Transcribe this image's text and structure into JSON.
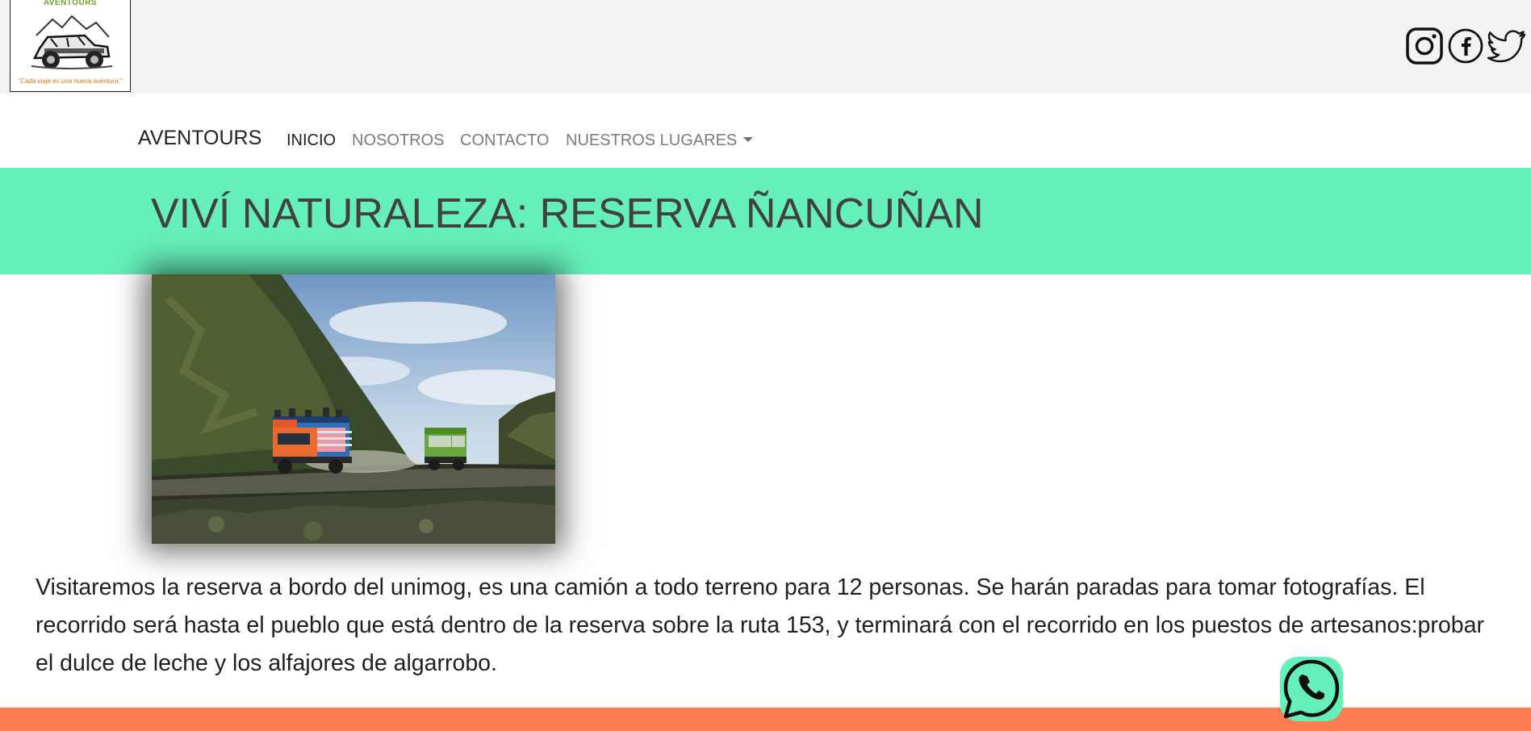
{
  "header": {
    "logo": {
      "brand": "AVENTOURS",
      "slogan": "\"Cada viaje es una nueva aventura.\""
    },
    "social_icons": [
      "instagram-icon",
      "facebook-icon",
      "twitter-icon"
    ]
  },
  "navbar": {
    "brand": "AVENTOURS",
    "items": [
      {
        "label": "INICIO",
        "active": true
      },
      {
        "label": "NOSOTROS",
        "active": false
      },
      {
        "label": "CONTACTO",
        "active": false
      },
      {
        "label": "NUESTROS LUGARES",
        "active": false,
        "dropdown": true
      }
    ]
  },
  "hero": {
    "title": "VIVÍ NATURALEZA: RESERVA ÑANCUÑAN"
  },
  "content": {
    "description": "Visitaremos la reserva a bordo del unimog, es una camión a todo terreno para 12 personas. Se harán paradas para tomar fotografías. El recorrido será hasta el pueblo que está dentro de la reserva sobre la ruta 153, y terminará con el recorrido en los puestos de artesanos:probar el dulce de leche y los alfajores de algarrobo."
  },
  "floating": {
    "icon": "whatsapp-icon"
  },
  "colors": {
    "topbar": "#f3f3f3",
    "banner": "#65efb9",
    "footer": "#fd7b50",
    "title_text": "#414141"
  }
}
